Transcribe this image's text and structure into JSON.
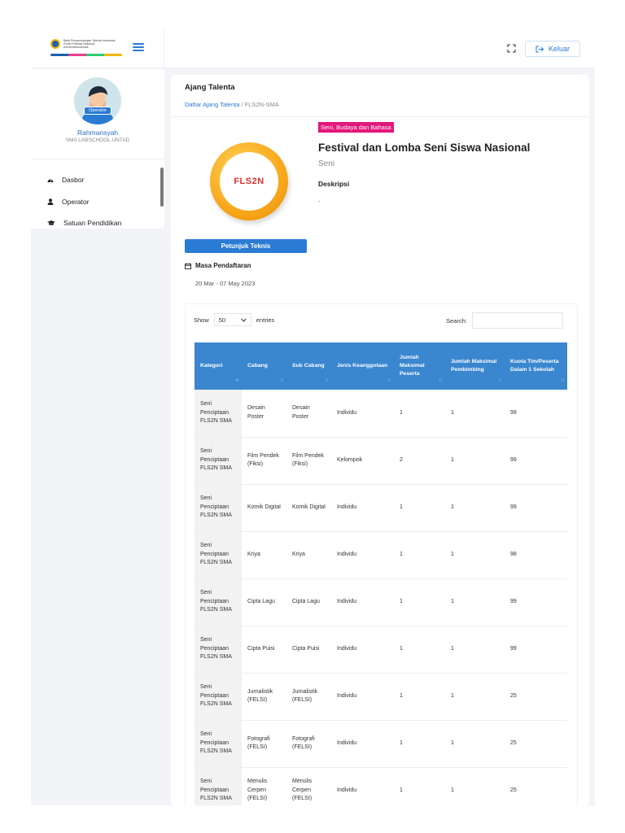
{
  "topbar": {
    "logo_lines": [
      "Balai Pengembangan Talenta Indonesia",
      "Pusat Prestasi Nasional",
      "Kemendikbudristek"
    ],
    "logout_label": "Keluar",
    "icons": {
      "menu": "hamburger-icon",
      "fullscreen": "expand-icon",
      "logout": "logout-icon"
    }
  },
  "sidebar": {
    "role_badge": "Operator",
    "user_name": "Rahmansyah",
    "school": "SMA LABSCHOOL UNTAD",
    "items": [
      {
        "label": "Dasbor",
        "icon": "dashboard-icon"
      },
      {
        "label": "Operator",
        "icon": "user-icon"
      },
      {
        "label": "Satuan Pendidikan",
        "icon": "graduation-cap-icon"
      }
    ]
  },
  "page": {
    "title": "Ajang Talenta",
    "breadcrumb_link": "Daftar Ajang Talenta",
    "breadcrumb_sep": "/",
    "breadcrumb_current": "FLS2N-SMA"
  },
  "event": {
    "emblem_text": "FLS2N",
    "tag": "Seni, Budaya dan Bahasa",
    "title": "Festival dan Lomba Seni Siswa Nasional",
    "subtitle": "Seni",
    "description_label": "Deskripsi",
    "description": "-",
    "tech_button": "Petunjuk Teknis",
    "registration_label": "Masa Pendaftaran",
    "registration_dates": "20 Mar - 07 May 2023"
  },
  "table_controls": {
    "show_label": "Show",
    "show_value": "50",
    "entries_label": "entries",
    "search_label": "Search:"
  },
  "table": {
    "headers": [
      "Kategori",
      "Cabang",
      "Sub Cabang",
      "Jenis Keanggotaan",
      "Jumlah Maksimal Peserta",
      "Jumlah Maksimal Pembimbing",
      "Kuota Tim/Peserta Dalam 1 Sekolah"
    ],
    "rows": [
      [
        "Seni Penciptaan FLS2N SMA",
        "Desain Poster",
        "Desain Poster",
        "Individu",
        "1",
        "1",
        "99"
      ],
      [
        "Seni Penciptaan FLS2N SMA",
        "Film Pendek (Fiksi)",
        "Film Pendek (Fiksi)",
        "Kelompok",
        "2",
        "1",
        "99"
      ],
      [
        "Seni Penciptaan FLS2N SMA",
        "Komik Digital",
        "Komik Digital",
        "Individu",
        "1",
        "1",
        "99"
      ],
      [
        "Seni Penciptaan FLS2N SMA",
        "Kriya",
        "Kriya",
        "Individu",
        "1",
        "1",
        "98"
      ],
      [
        "Seni Penciptaan FLS2N SMA",
        "Cipta Lagu",
        "Cipta Lagu",
        "Individu",
        "1",
        "1",
        "99"
      ],
      [
        "Seni Penciptaan FLS2N SMA",
        "Cipta Puisi",
        "Cipta Puisi",
        "Individu",
        "1",
        "1",
        "99"
      ],
      [
        "Seni Penciptaan FLS2N SMA",
        "Jurnalistik (FELSI)",
        "Jurnalistik (FELSI)",
        "Individu",
        "1",
        "1",
        "25"
      ],
      [
        "Seni Penciptaan FLS2N SMA",
        "Fotografi (FELSI)",
        "Fotografi (FELSI)",
        "Individu",
        "1",
        "1",
        "25"
      ],
      [
        "Seni Penciptaan FLS2N SMA",
        "Menulis Cerpen (FELSI)",
        "Menulis Cerpen (FELSI)",
        "Individu",
        "1",
        "1",
        "25"
      ]
    ]
  },
  "colors": {
    "primary": "#2a7bd4",
    "table_header": "#3a86cf",
    "tag": "#e3177a",
    "emblem": "#f8a71a"
  }
}
